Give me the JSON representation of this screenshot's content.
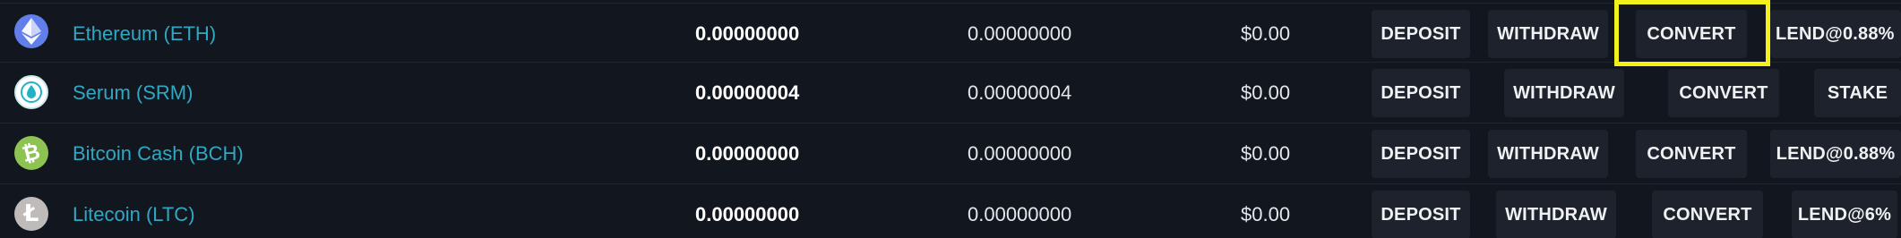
{
  "rows": [
    {
      "name": "Ethereum (ETH)",
      "total": "0.00000000",
      "available": "0.00000000",
      "usd": "$0.00",
      "deposit": "DEPOSIT",
      "withdraw": "WITHDRAW",
      "convert": "CONVERT",
      "extra": "LEND@0.88%",
      "icon": "ethereum-icon",
      "icon_color": "#627eea"
    },
    {
      "name": "Serum (SRM)",
      "total": "0.00000004",
      "available": "0.00000004",
      "usd": "$0.00",
      "deposit": "DEPOSIT",
      "withdraw": "WITHDRAW",
      "convert": "CONVERT",
      "extra": "STAKE",
      "icon": "serum-icon",
      "icon_color": "#ffffff"
    },
    {
      "name": "Bitcoin Cash (BCH)",
      "total": "0.00000000",
      "available": "0.00000000",
      "usd": "$0.00",
      "deposit": "DEPOSIT",
      "withdraw": "WITHDRAW",
      "convert": "CONVERT",
      "extra": "LEND@0.88%",
      "icon": "bitcoin-cash-icon",
      "icon_color": "#8dc351"
    },
    {
      "name": "Litecoin (LTC)",
      "total": "0.00000000",
      "available": "0.00000000",
      "usd": "$0.00",
      "deposit": "DEPOSIT",
      "withdraw": "WITHDRAW",
      "convert": "CONVERT",
      "extra": "LEND@6%",
      "icon": "litecoin-icon",
      "icon_color": "#bfbbbb"
    }
  ],
  "highlight_color": "#f4f01a"
}
